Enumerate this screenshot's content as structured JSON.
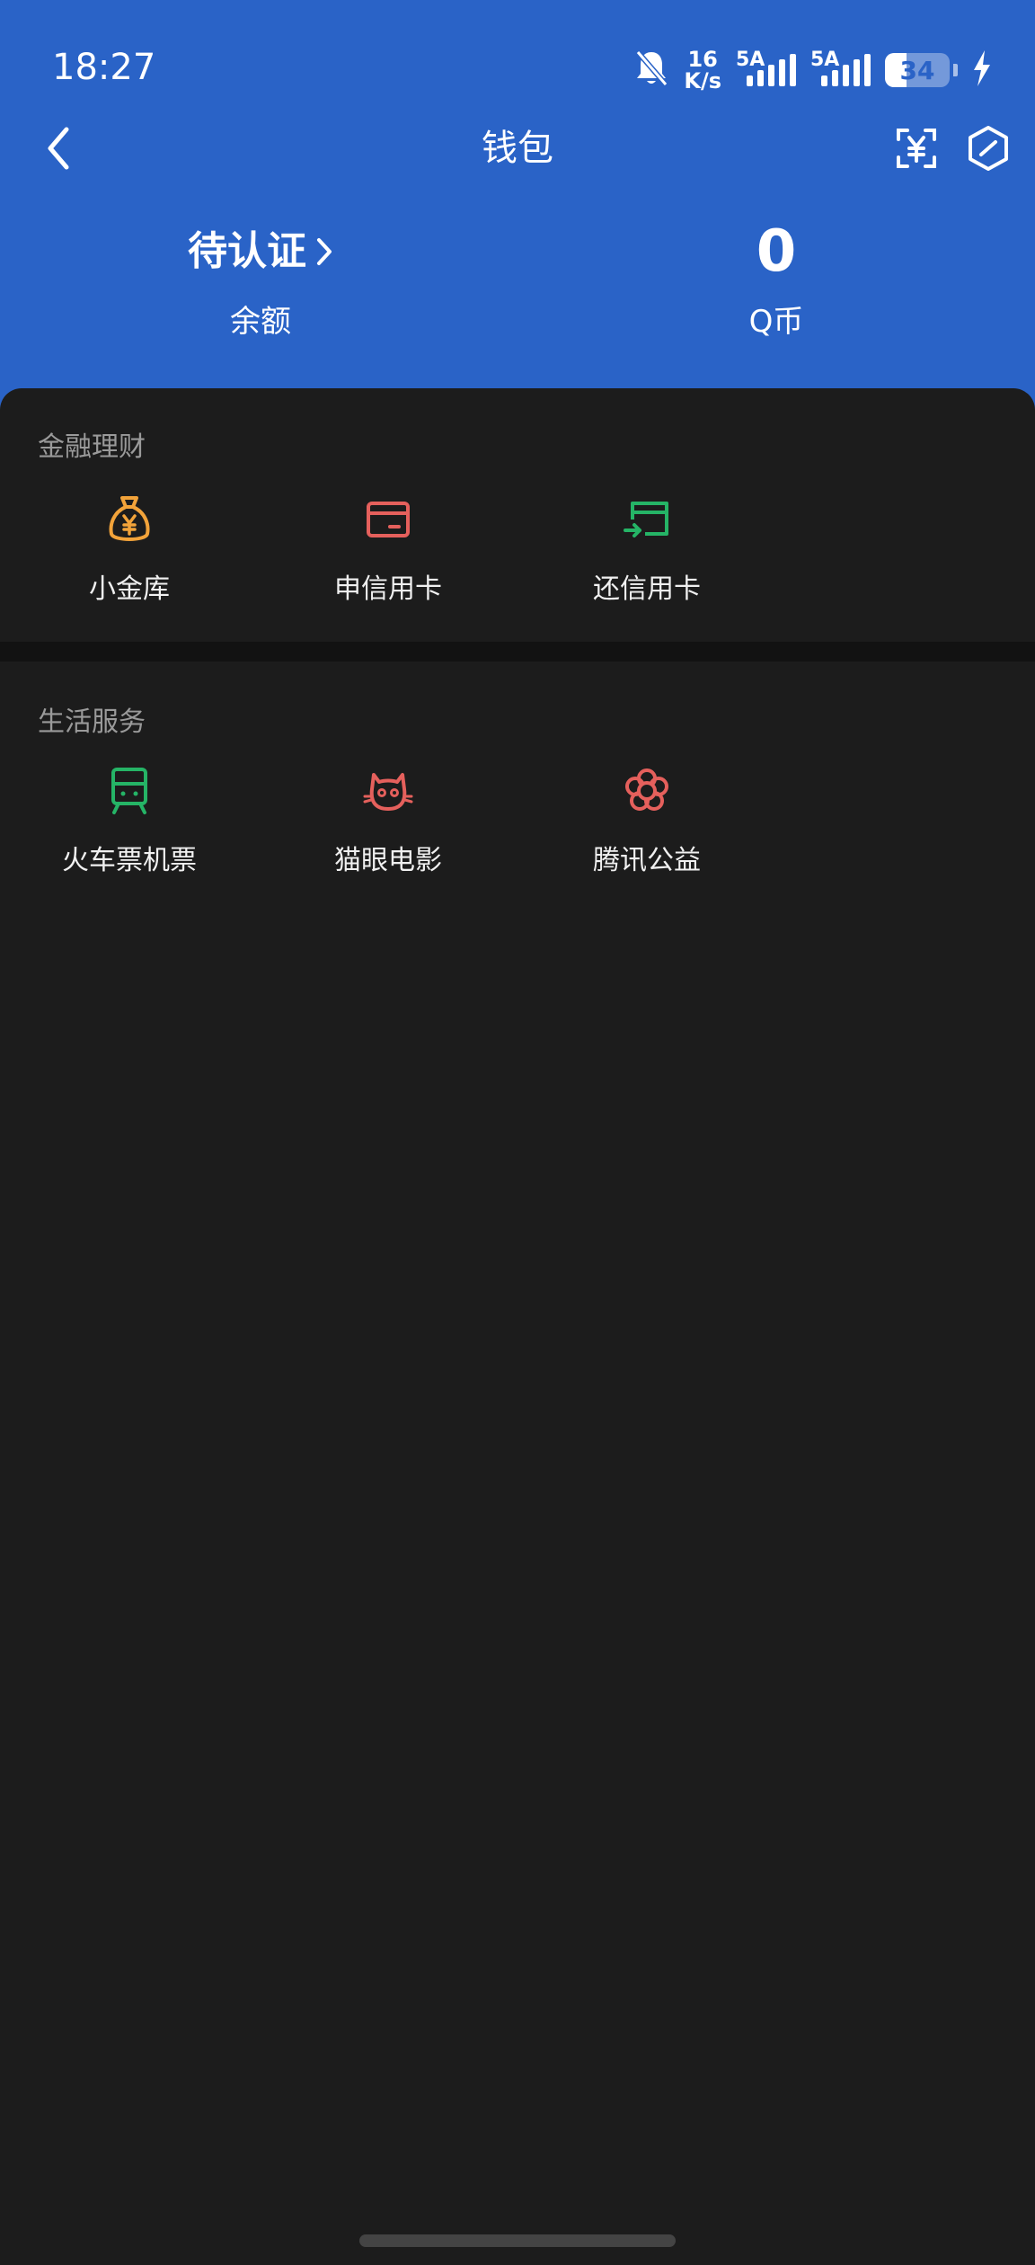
{
  "status_bar": {
    "time": "18:27",
    "net_speed_value": "16",
    "net_speed_unit": "K/s",
    "sim1_label": "5A",
    "sim2_label": "5A",
    "battery_level": "34"
  },
  "title_bar": {
    "title": "钱包"
  },
  "balances": {
    "balance_value": "待认证",
    "balance_label": "余额",
    "qcoin_value": "0",
    "qcoin_label": "Q币"
  },
  "finance_section": {
    "title": "金融理财",
    "items": [
      {
        "label": "小金库",
        "icon": "money-bag-icon",
        "color": "#f2a33a"
      },
      {
        "label": "申信用卡",
        "icon": "credit-card-icon",
        "color": "#e5605c"
      },
      {
        "label": "还信用卡",
        "icon": "card-repay-icon",
        "color": "#25b466"
      }
    ]
  },
  "life_section": {
    "title": "生活服务",
    "items": [
      {
        "label": "火车票机票",
        "icon": "train-icon",
        "color": "#25b466"
      },
      {
        "label": "猫眼电影",
        "icon": "cat-icon",
        "color": "#e5605c"
      },
      {
        "label": "腾讯公益",
        "icon": "flower-icon",
        "color": "#e5605c"
      }
    ]
  },
  "colors": {
    "header_bg": "#2a63c7",
    "body_bg": "#1c1c1c"
  }
}
